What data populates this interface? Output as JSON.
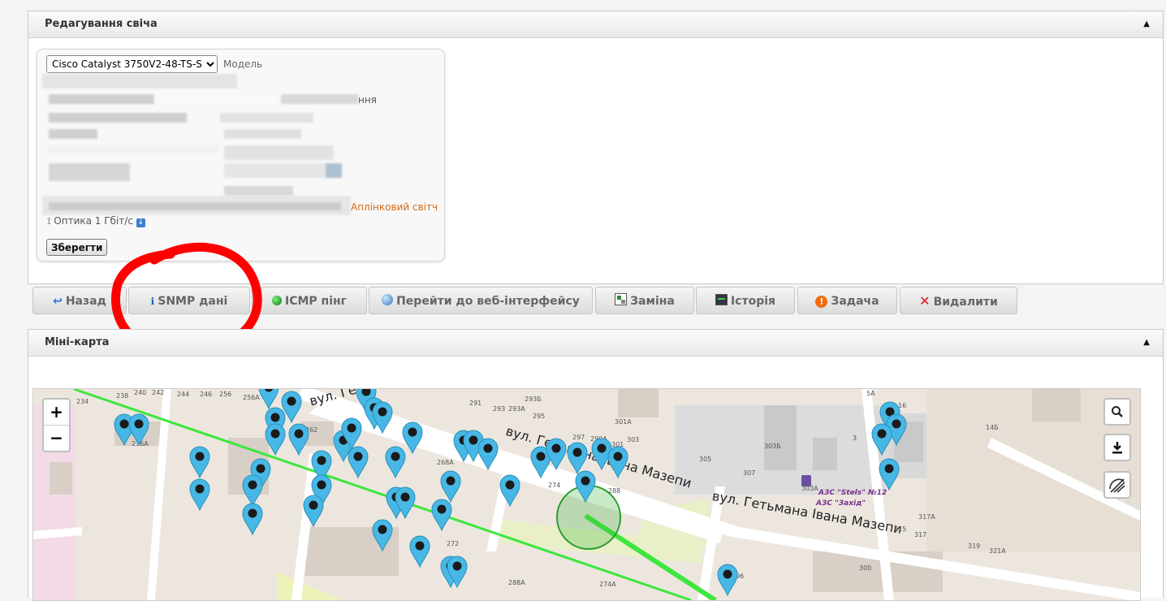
{
  "edit_panel": {
    "title": "Редагування свіча",
    "collapse_glyph": "▲",
    "model_value": "Cisco Catalyst 3750V2-48-TS-S",
    "model_label": "Модель",
    "partial_text": "ння",
    "uplink_label": "Аплінковий світч",
    "optics_label": "Оптика 1 Гбіт/с",
    "save_label": "Зберегти"
  },
  "toolbar": {
    "buttons": [
      {
        "label": "Назад",
        "icon": "back-arrow-icon"
      },
      {
        "label": "SNMP дані",
        "icon": "info-icon"
      },
      {
        "label": "ICMP пінг",
        "icon": "green-dot-icon"
      },
      {
        "label": "Перейти до веб-інтерфейсу",
        "icon": "globe-icon"
      },
      {
        "label": "Заміна",
        "icon": "replace-icon"
      },
      {
        "label": "Історія",
        "icon": "history-icon"
      },
      {
        "label": "Задача",
        "icon": "warning-icon"
      },
      {
        "label": "Видалити",
        "icon": "delete-x-icon"
      }
    ]
  },
  "map_panel": {
    "title": "Міні-карта",
    "collapse_glyph": "▲",
    "zoom_in": "+",
    "zoom_out": "−",
    "street_1": "вул. Гетьмана Івана Мазепи",
    "street_2": "вул. Гетьмана Івана Мазепи",
    "street_3": "вул. Гетьмана Івана Мазепи",
    "azs_1": "АЗС \"Stels\" №12",
    "azs_2": "АЗС \"Захід\"",
    "house_numbers": [
      "234",
      "238",
      "240",
      "242",
      "244",
      "246",
      "256",
      "256А",
      "291",
      "293",
      "293А",
      "293Б",
      "295",
      "297",
      "299А",
      "301",
      "301А",
      "303",
      "268А",
      "274",
      "288",
      "272",
      "288А",
      "274А",
      "262",
      "236А",
      "305",
      "303Б",
      "307",
      "3",
      "5А",
      "16",
      "14Б",
      "14",
      "317А",
      "315",
      "317",
      "319",
      "321А",
      "300",
      "296",
      "303А"
    ]
  },
  "colors": {
    "accent_red": "#ff0000",
    "route_green": "#3ee63e",
    "pin_blue": "#47b8e6",
    "uplink_orange": "#d46a12"
  }
}
